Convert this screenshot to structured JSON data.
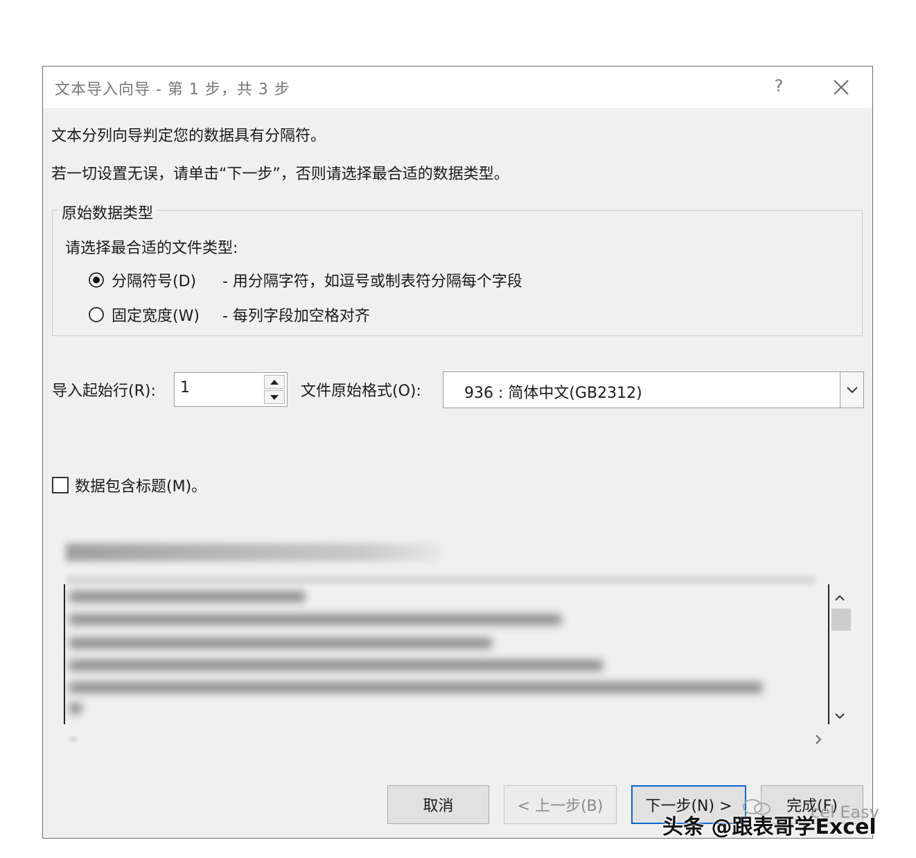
{
  "dialog": {
    "title": "文本导入向导 - 第 1 步，共 3 步",
    "help_label": "?",
    "line1": "文本分列向导判定您的数据具有分隔符。",
    "line2": "若一切设置无误，请单击“下一步”，否则请选择最合适的数据类型。"
  },
  "group": {
    "legend": "原始数据类型",
    "prompt": "请选择最合适的文件类型:",
    "options": [
      {
        "label": "分隔符号(D)",
        "desc": "- 用分隔字符，如逗号或制表符分隔每个字段",
        "checked": true
      },
      {
        "label": "固定宽度(W)",
        "desc": "- 每列字段加空格对齐",
        "checked": false
      }
    ]
  },
  "start_row": {
    "label": "导入起始行(R):",
    "value": "1"
  },
  "file_origin": {
    "label": "文件原始格式(O):",
    "value": "936 : 简体中文(GB2312)"
  },
  "header_checkbox": {
    "label": "数据包含标题(M)。",
    "checked": false
  },
  "buttons": {
    "cancel": "取消",
    "back": "< 上一步(B)",
    "next": "下一步(N) >",
    "finish": "完成(F)"
  },
  "watermark": {
    "text": "头条 @跟表哥学Excel",
    "sub": "cel Easy"
  },
  "colors": {
    "dialog_bg": "#f0f0f0",
    "accent_border": "#0a66cf"
  }
}
